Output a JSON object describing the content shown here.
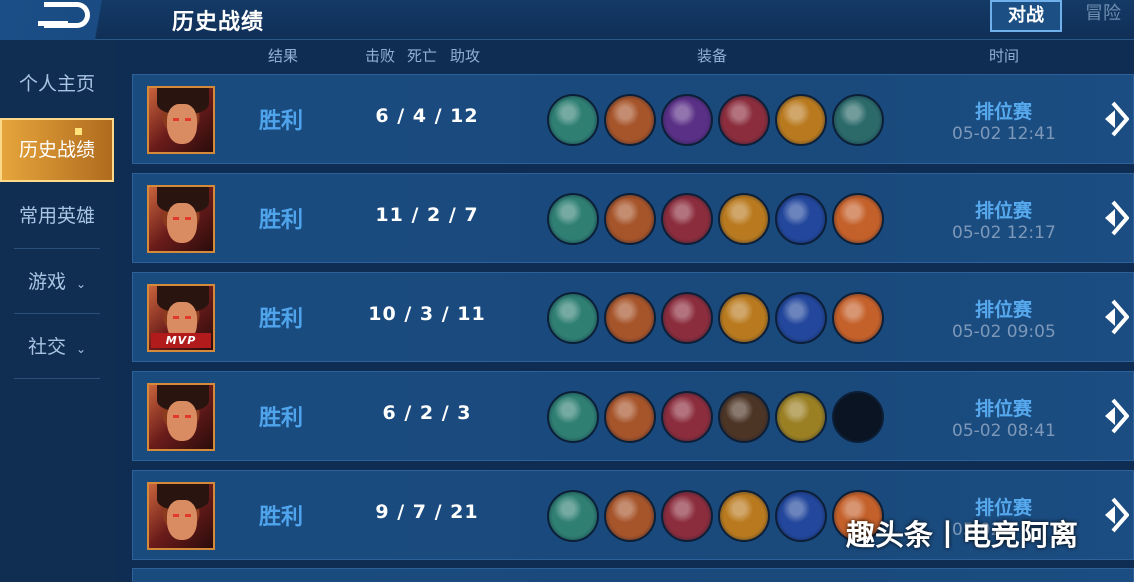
{
  "header": {
    "title": "历史战绩",
    "tabs": [
      {
        "label": "对战",
        "active": true
      },
      {
        "label": "冒险",
        "active": false
      }
    ]
  },
  "sidebar": {
    "items": [
      {
        "label": "个人主页",
        "active": false
      },
      {
        "label": "历史战绩",
        "active": true
      },
      {
        "label": "常用英雄",
        "active": false
      },
      {
        "label": "游戏",
        "active": false,
        "expandable": true
      },
      {
        "label": "社交",
        "active": false,
        "expandable": true
      }
    ]
  },
  "columns": {
    "result": "结果",
    "kills": "击败",
    "deaths": "死亡",
    "assists": "助攻",
    "equipment": "装备",
    "time": "时间"
  },
  "matches": [
    {
      "result": "胜利",
      "kda": "6 / 4 / 12",
      "mode": "排位赛",
      "time": "05-02  12:41",
      "mvp": "",
      "items": [
        "boots-item-icon",
        "blade-item-icon",
        "green-gem-item-icon",
        "red-armor-item-icon",
        "fire-blade-item-icon",
        "green-sword-item-icon"
      ]
    },
    {
      "result": "胜利",
      "kda": "11 / 2 / 7",
      "mode": "排位赛",
      "time": "05-02  12:17",
      "mvp": "",
      "items": [
        "boots-item-icon",
        "blade-item-icon",
        "red-armor-item-icon",
        "fire-blade-item-icon",
        "blue-spear-item-icon",
        "orange-axe-item-icon"
      ]
    },
    {
      "result": "胜利",
      "kda": "10 / 3 / 11",
      "mode": "排位赛",
      "time": "05-02  09:05",
      "mvp": "MVP",
      "items": [
        "boots-item-icon",
        "blade-item-icon",
        "red-armor-item-icon",
        "fire-blade-item-icon",
        "blue-spear-item-icon",
        "orange-axe-item-icon"
      ]
    },
    {
      "result": "胜利",
      "kda": "6 / 2 / 3",
      "mode": "排位赛",
      "time": "05-02  08:41",
      "mvp": "",
      "items": [
        "boots-item-icon",
        "blade-item-icon",
        "red-armor-item-icon",
        "gauntlet-item-icon",
        "gold-blade-item-icon",
        "empty-slot-icon"
      ]
    },
    {
      "result": "胜利",
      "kda": "9 / 7 / 21",
      "mode": "排位赛",
      "time": "05-02",
      "mvp": "",
      "items": [
        "boots-item-icon",
        "blade-item-icon",
        "red-armor-item-icon",
        "fire-blade-item-icon",
        "blue-spear-item-icon",
        "orange-axe-item-icon"
      ]
    }
  ],
  "item_colors": {
    "boots-item-icon": "#2f7f73",
    "blade-item-icon": "#a6542a",
    "green-gem-item-icon": "#5a2f86",
    "red-armor-item-icon": "#8b2d3d",
    "fire-blade-item-icon": "#b97a1f",
    "green-sword-item-icon": "#2c6a6a",
    "blue-spear-item-icon": "#23479c",
    "orange-axe-item-icon": "#c4602a",
    "gauntlet-item-icon": "#4d3526",
    "gold-blade-item-icon": "#9a7f23",
    "empty-slot-icon": "#0b1422"
  },
  "watermark": "趣头条丨电竞阿离"
}
